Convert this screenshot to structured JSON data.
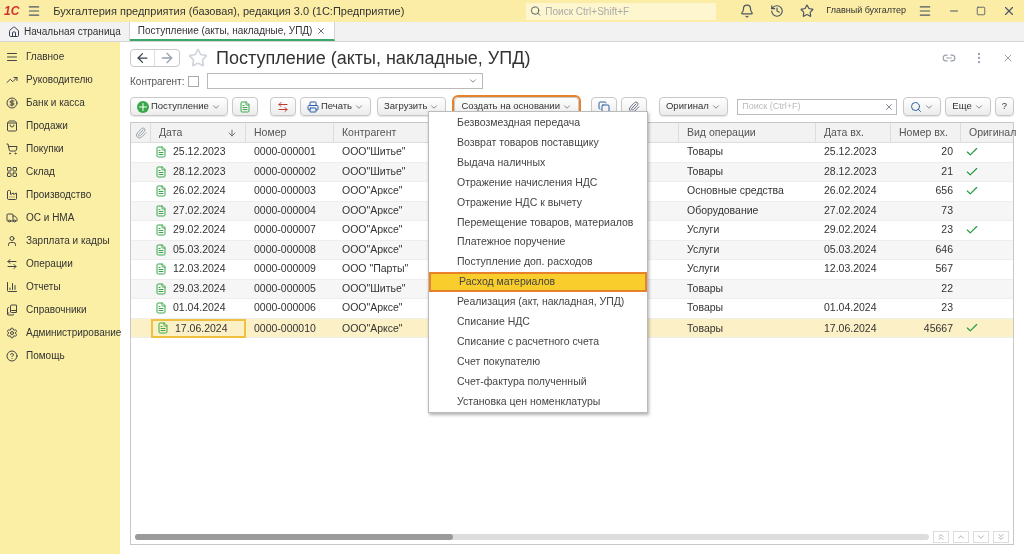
{
  "app": {
    "logo": "1С",
    "title": "Бухгалтерия предприятия (базовая), редакция 3.0  (1С:Предприятие)",
    "search_placeholder": "Поиск Ctrl+Shift+F",
    "user": "Главный бухгалтер"
  },
  "tabs": [
    {
      "label": "Начальная страница",
      "selected": false,
      "closable": false
    },
    {
      "label": "Поступление (акты, накладные, УПД)",
      "selected": true,
      "closable": true
    }
  ],
  "sidebar": {
    "items": [
      {
        "label": "Главное"
      },
      {
        "label": "Руководителю"
      },
      {
        "label": "Банк и касса"
      },
      {
        "label": "Продажи"
      },
      {
        "label": "Покупки"
      },
      {
        "label": "Склад"
      },
      {
        "label": "Производство"
      },
      {
        "label": "ОС и НМА"
      },
      {
        "label": "Зарплата и кадры"
      },
      {
        "label": "Операции"
      },
      {
        "label": "Отчеты"
      },
      {
        "label": "Справочники"
      },
      {
        "label": "Администрирование"
      },
      {
        "label": "Помощь"
      }
    ]
  },
  "form": {
    "title": "Поступление (акты, накладные, УПД)",
    "favorite": false,
    "counterparty_label": "Контрагент:",
    "counterparty_checked": false,
    "toolbar": {
      "create": "Поступление",
      "print": "Печать",
      "load": "Загрузить",
      "based_on": "Создать на основании",
      "based_on_expanded": true,
      "original": "Оригинал",
      "search_placeholder": "Поиск (Ctrl+F)",
      "more": "Еще",
      "help": "?"
    }
  },
  "table": {
    "columns": [
      "Дата",
      "Номер",
      "Контрагент",
      "Вид операции",
      "Дата вх.",
      "Номер вх.",
      "Оригинал"
    ],
    "rows": [
      {
        "date": "25.12.2023",
        "number": "0000-000001",
        "counterparty": "ООО\"Шитье\"",
        "operation": "Товары",
        "in_date": "25.12.2023",
        "in_number": "20",
        "original": true,
        "selected": false
      },
      {
        "date": "28.12.2023",
        "number": "0000-000002",
        "counterparty": "ООО\"Шитье\"",
        "operation": "Товары",
        "in_date": "28.12.2023",
        "in_number": "21",
        "original": true,
        "selected": false
      },
      {
        "date": "26.02.2024",
        "number": "0000-000003",
        "counterparty": "ООО\"Арксе\"",
        "operation": "Основные средства",
        "in_date": "26.02.2024",
        "in_number": "656",
        "original": true,
        "selected": false
      },
      {
        "date": "27.02.2024",
        "number": "0000-000004",
        "counterparty": "ООО\"Арксе\"",
        "operation": "Оборудование",
        "in_date": "27.02.2024",
        "in_number": "73",
        "original": false,
        "selected": false
      },
      {
        "date": "29.02.2024",
        "number": "0000-000007",
        "counterparty": "ООО\"Арксе\"",
        "operation": "Услуги",
        "in_date": "29.02.2024",
        "in_number": "23",
        "original": true,
        "selected": false
      },
      {
        "date": "05.03.2024",
        "number": "0000-000008",
        "counterparty": "ООО\"Арксе\"",
        "operation": "Услуги",
        "in_date": "05.03.2024",
        "in_number": "646",
        "original": false,
        "selected": false
      },
      {
        "date": "12.03.2024",
        "number": "0000-000009",
        "counterparty": "ООО \"Парты\"",
        "operation": "Услуги",
        "in_date": "12.03.2024",
        "in_number": "567",
        "original": false,
        "selected": false
      },
      {
        "date": "29.03.2024",
        "number": "0000-000005",
        "counterparty": "ООО\"Шитье\"",
        "operation": "Товары",
        "in_date": "",
        "in_number": "22",
        "original": false,
        "selected": false
      },
      {
        "date": "01.04.2024",
        "number": "0000-000006",
        "counterparty": "ООО\"Арксе\"",
        "operation": "Товары",
        "in_date": "01.04.2024",
        "in_number": "23",
        "original": false,
        "selected": false
      },
      {
        "date": "17.06.2024",
        "number": "0000-000010",
        "counterparty": "ООО\"Арксе\"",
        "operation": "Товары",
        "in_date": "17.06.2024",
        "in_number": "45667",
        "original": true,
        "selected": true
      }
    ]
  },
  "menu": {
    "items": [
      {
        "label": "Безвозмездная передача",
        "selected": false
      },
      {
        "label": "Возврат товаров поставщику",
        "selected": false
      },
      {
        "label": "Выдача наличных",
        "selected": false
      },
      {
        "label": "Отражение начисления НДС",
        "selected": false
      },
      {
        "label": "Отражение НДС к вычету",
        "selected": false
      },
      {
        "label": "Перемещение товаров, материалов",
        "selected": false
      },
      {
        "label": "Платежное поручение",
        "selected": false
      },
      {
        "label": "Поступление доп. расходов",
        "selected": false
      },
      {
        "label": "Расход материалов",
        "selected": true
      },
      {
        "label": "Реализация (акт, накладная, УПД)",
        "selected": false
      },
      {
        "label": "Списание НДС",
        "selected": false
      },
      {
        "label": "Списание с расчетного счета",
        "selected": false
      },
      {
        "label": "Счет покупателю",
        "selected": false
      },
      {
        "label": "Счет-фактура полученный",
        "selected": false
      },
      {
        "label": "Установка цен номенклатуры",
        "selected": false
      }
    ]
  }
}
